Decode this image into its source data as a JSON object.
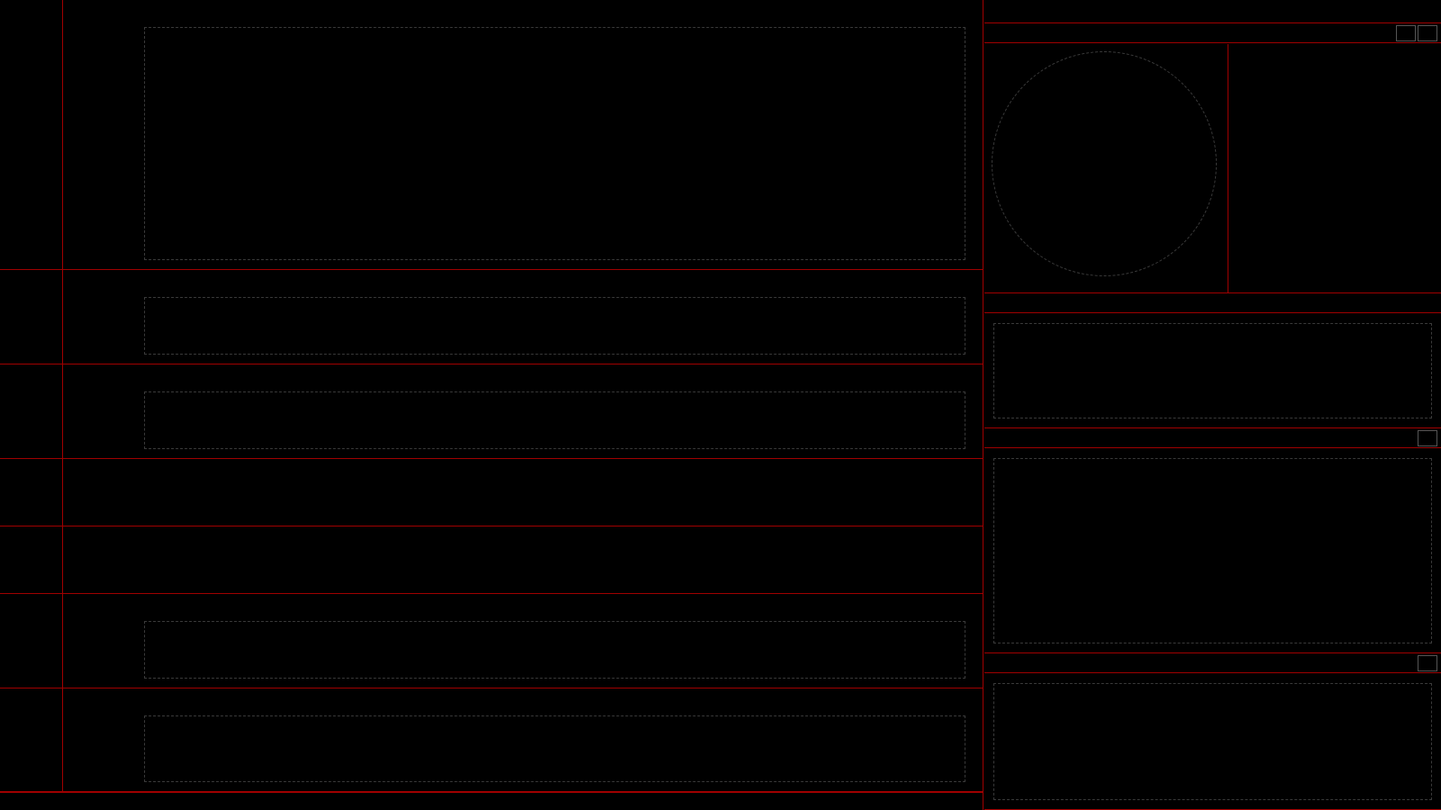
{
  "stock": {
    "code": "",
    "name": ""
  },
  "main_panel": {
    "header": ""
  },
  "vol_panel": {
    "header": ""
  },
  "svzj_panel": {
    "header": ""
  },
  "svzl_panel": {
    "header": ""
  },
  "svsh_panel": {
    "header": ""
  },
  "ai1_panel": {
    "header": ""
  },
  "ai2_panel": {
    "header": ""
  },
  "status": {
    "brand": ""
  },
  "right": {
    "lhb_title": "",
    "fs_title": "",
    "sz_title": "",
    "cat_title": "",
    "order_rows": []
  },
  "chart_data": []
}
